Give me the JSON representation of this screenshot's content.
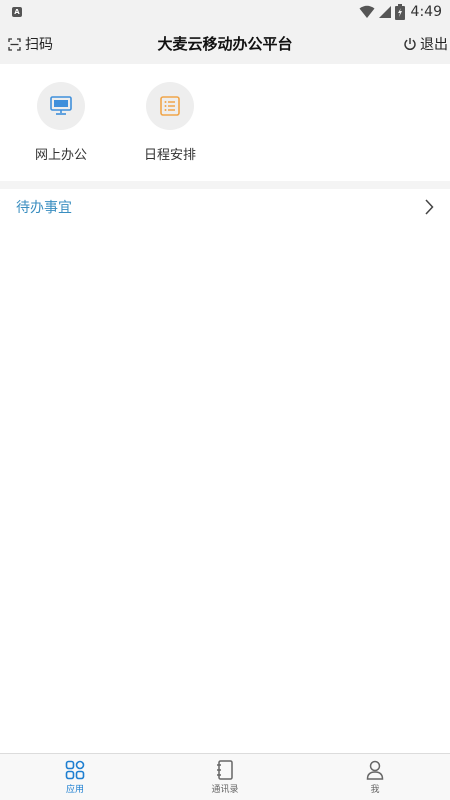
{
  "status_bar": {
    "left_icon_letter": "A",
    "time": "4:49"
  },
  "header": {
    "scan_label": "扫码",
    "title": "大麦云移动办公平台",
    "logout_label": "退出"
  },
  "apps": [
    {
      "label": "网上办公",
      "icon": "monitor-icon",
      "color": "#3f8fdb"
    },
    {
      "label": "日程安排",
      "icon": "list-document-icon",
      "color": "#f0a54a"
    }
  ],
  "todo": {
    "label": "待办事宜"
  },
  "bottom_nav": [
    {
      "label": "应用",
      "icon": "grid-apps-icon",
      "active": true
    },
    {
      "label": "通讯录",
      "icon": "contacts-book-icon",
      "active": false
    },
    {
      "label": "我",
      "icon": "person-icon",
      "active": false
    }
  ],
  "colors": {
    "accent": "#1e7fd1",
    "link": "#3a8ec0",
    "header_bg": "#f2f2f2"
  }
}
